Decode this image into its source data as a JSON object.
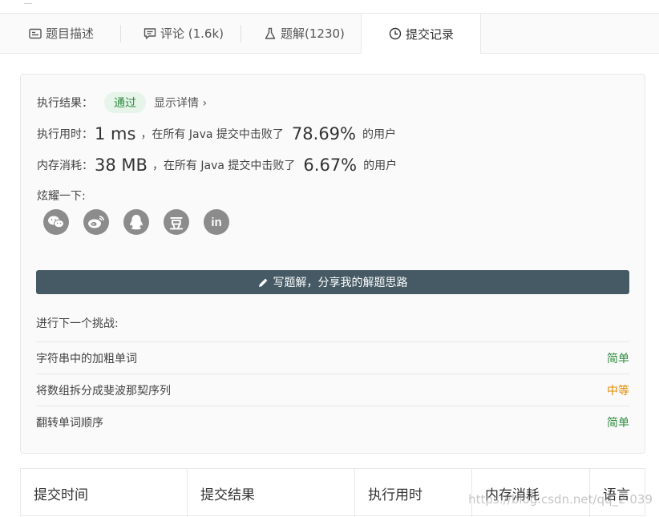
{
  "tabs": [
    {
      "label": "题目描述",
      "icon": "description-icon"
    },
    {
      "label": "评论 (1.6k)",
      "icon": "comment-icon"
    },
    {
      "label": "题解(1230)",
      "icon": "flask-icon"
    },
    {
      "label": "提交记录",
      "icon": "clock-icon",
      "active": true
    }
  ],
  "result": {
    "label": "执行结果：",
    "status": "通过",
    "detail_link": "显示详情 ›"
  },
  "runtime": {
    "label": "执行用时：",
    "value": "1 ms",
    "middle": "，在所有 Java 提交中击败了",
    "percent": "78.69%",
    "suffix": "的用户"
  },
  "memory": {
    "label": "内存消耗：",
    "value": "38 MB",
    "middle": "，在所有 Java 提交中击败了",
    "percent": "6.67%",
    "suffix": "的用户"
  },
  "share": {
    "label": "炫耀一下:",
    "buttons": [
      "wechat-icon",
      "weibo-icon",
      "qq-icon",
      "douban-icon",
      "linkedin-icon"
    ],
    "douban_glyph": "豆",
    "linkedin_glyph": "in"
  },
  "write_solution": "写题解，分享我的解题思路",
  "next": {
    "label": "进行下一个挑战:",
    "items": [
      {
        "title": "字符串中的加粗单词",
        "difficulty": "简单"
      },
      {
        "title": "将数组拆分成斐波那契序列",
        "difficulty": "中等"
      },
      {
        "title": "翻转单词顺序",
        "difficulty": "简单"
      }
    ]
  },
  "table_headers": [
    "提交时间",
    "提交结果",
    "执行用时",
    "内存消耗",
    "语言"
  ],
  "watermark": "https://blog.csdn.net/qq_2 039",
  "colors": {
    "pass_bg": "#e6f4ea",
    "easy": "#2e8b3f",
    "medium": "#e08a00",
    "button": "#455a64"
  }
}
